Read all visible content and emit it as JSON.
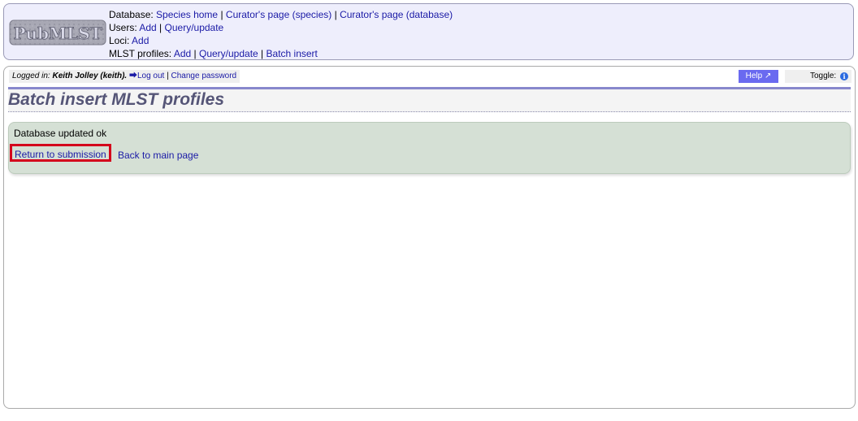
{
  "header": {
    "logo_text": "PubMLST",
    "database": {
      "label": "Database:",
      "links": [
        "Species home",
        "Curator's page (species)",
        "Curator's page (database)"
      ]
    },
    "users": {
      "label": "Users:",
      "links": [
        "Add",
        "Query/update"
      ]
    },
    "loci": {
      "label": "Loci:",
      "links": [
        "Add"
      ]
    },
    "profiles": {
      "label": "MLST profiles:",
      "links": [
        "Add",
        "Query/update",
        "Batch insert"
      ]
    },
    "separator": "|"
  },
  "login_bar": {
    "prefix": "Logged in:",
    "user": "Keith Jolley (keith).",
    "logout": "Log out",
    "change_password": "Change password"
  },
  "help_label": "Help",
  "toggle_label": "Toggle:",
  "page_title": "Batch insert MLST profiles",
  "status": {
    "message": "Database updated ok",
    "return_link": "Return to submission",
    "back_link": "Back to main page"
  },
  "colors": {
    "link": "#1a1aa6",
    "header_bg": "#eeeefc",
    "status_bg": "#d5e0d5",
    "highlight": "#d4001c",
    "title": "#555577"
  }
}
